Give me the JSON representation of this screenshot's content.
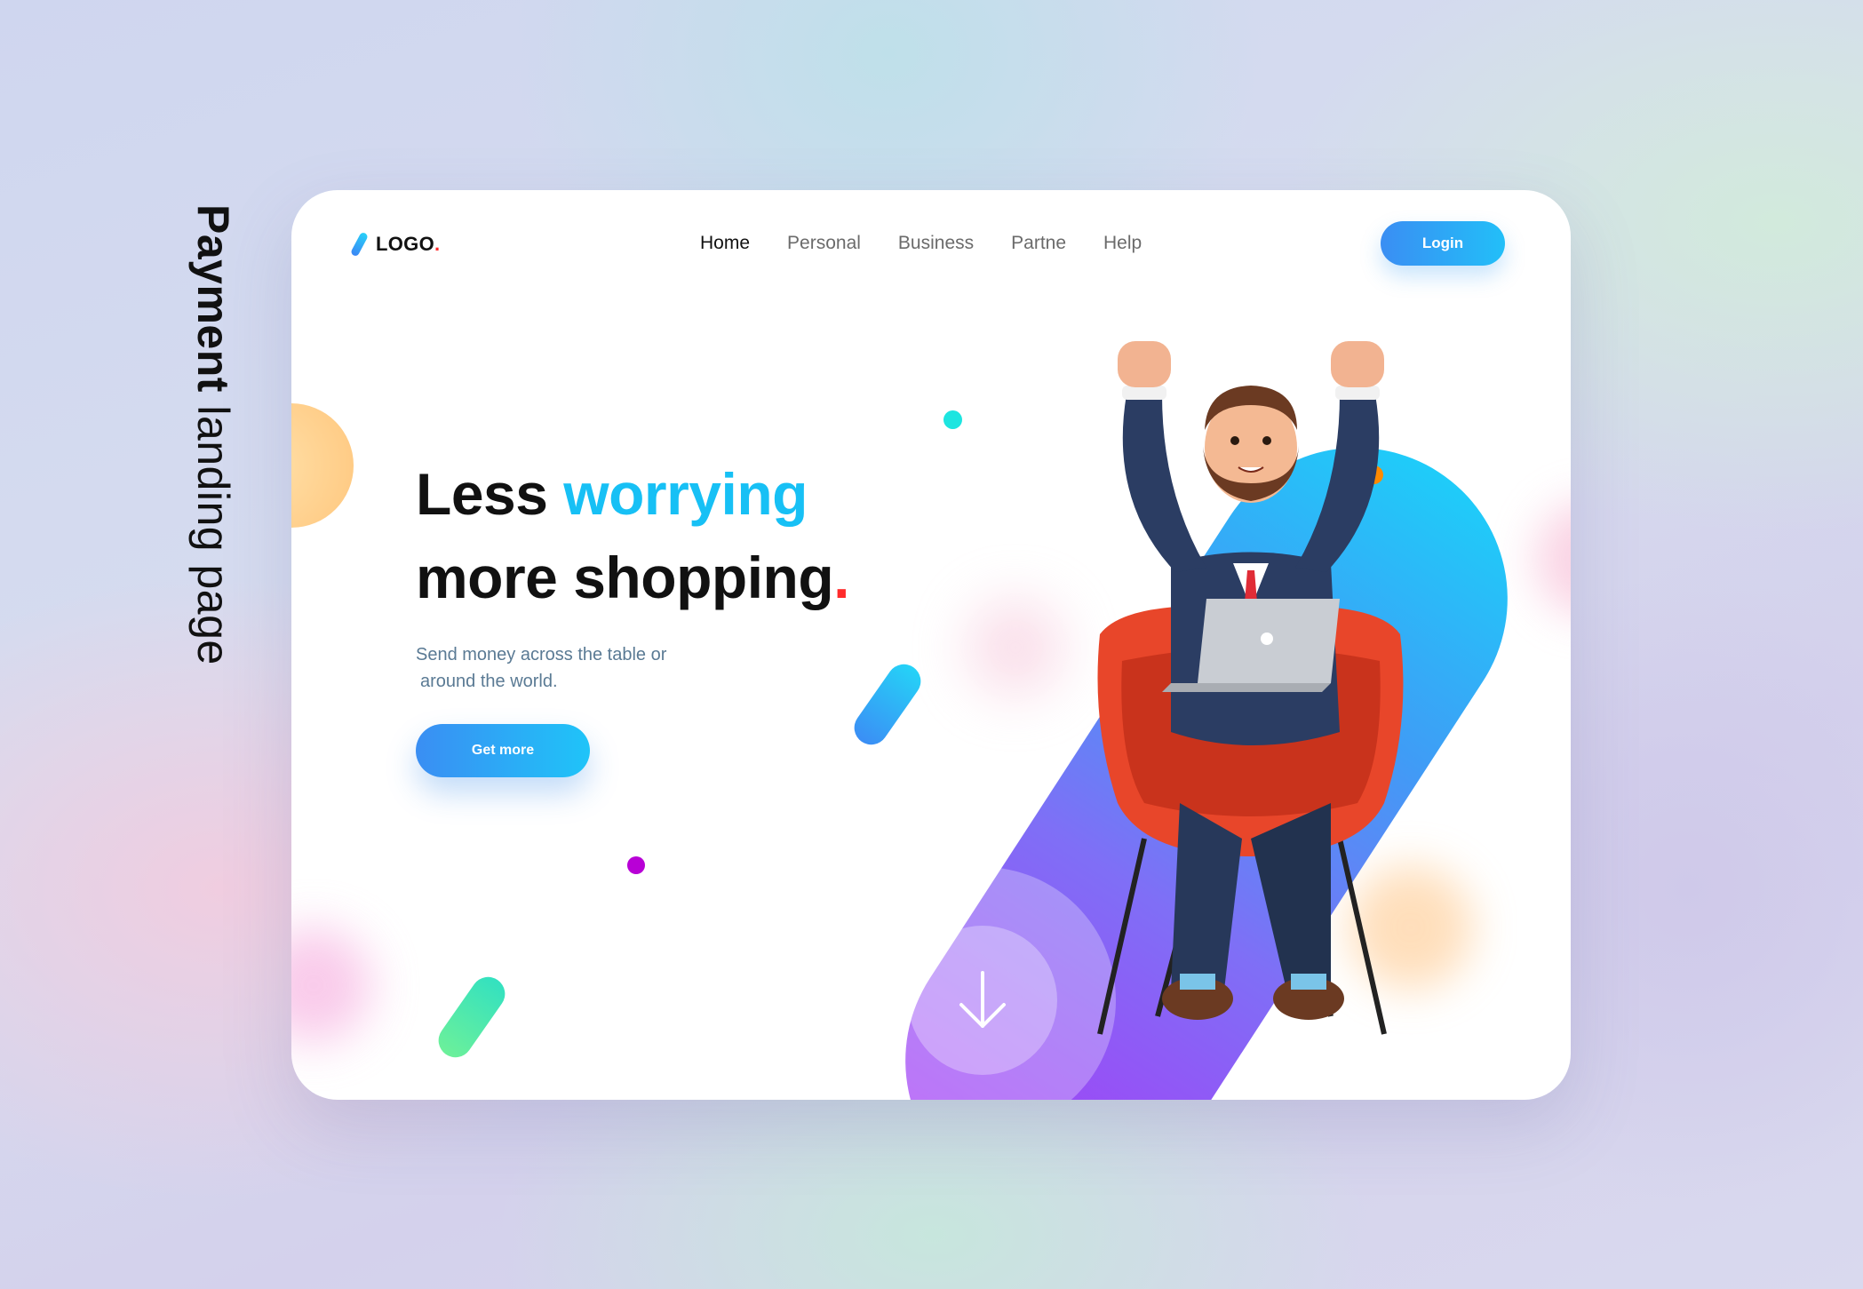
{
  "side_title": {
    "bold": "Payment",
    "rest": " landing page"
  },
  "header": {
    "logo_text": "LOGO",
    "logo_dot": ".",
    "nav": [
      "Home",
      "Personal",
      "Business",
      "Partne",
      "Help"
    ],
    "login_label": "Login"
  },
  "hero": {
    "line1_plain": "Less ",
    "line1_accent": "worrying",
    "line2": "more shopping",
    "line2_dot": ".",
    "sub_line1": "Send money across the table or",
    "sub_line2": "around the world.",
    "cta_label": "Get more"
  },
  "colors": {
    "accent": "#17c0f5",
    "brand_gradient_start": "#3a8ef3",
    "brand_gradient_end": "#22bff8",
    "dot_red": "#ff2b2b",
    "pill_purple": "#a73bf5"
  },
  "icons": {
    "scroll_down": "arrow-down-icon",
    "logo_mark": "slash-logo-icon"
  }
}
